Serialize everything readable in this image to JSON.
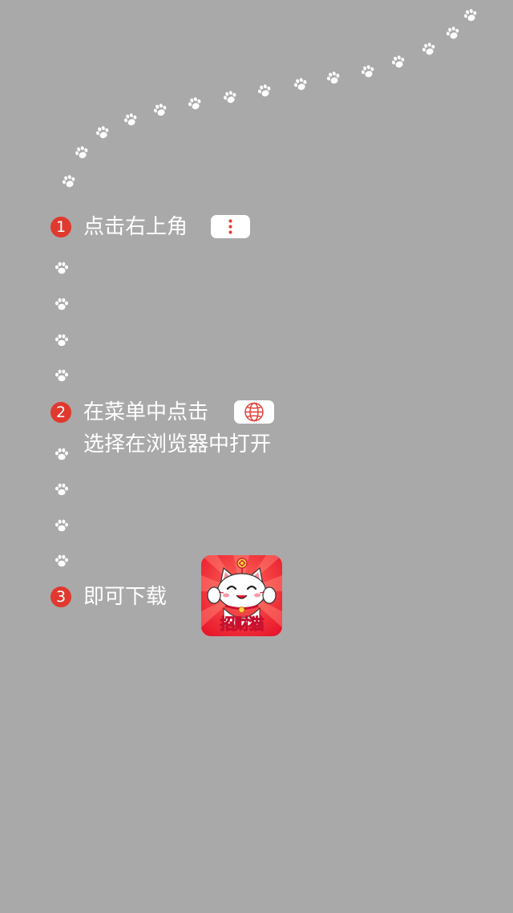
{
  "colors": {
    "background": "#a9a9a9",
    "accent": "#e0392f",
    "text": "#ffffff"
  },
  "steps": [
    {
      "number": "1",
      "text": "点击右上角",
      "icon": "more-vertical-icon"
    },
    {
      "number": "2",
      "text": "在菜单中点击",
      "icon": "globe-icon",
      "subtext": "选择在浏览器中打开"
    },
    {
      "number": "3",
      "text": "即可下载",
      "icon": "app-icon"
    }
  ],
  "app": {
    "name": "招财猫",
    "icon": "lucky-cat-icon"
  },
  "decorations": {
    "icon": "paw-print-icon"
  }
}
